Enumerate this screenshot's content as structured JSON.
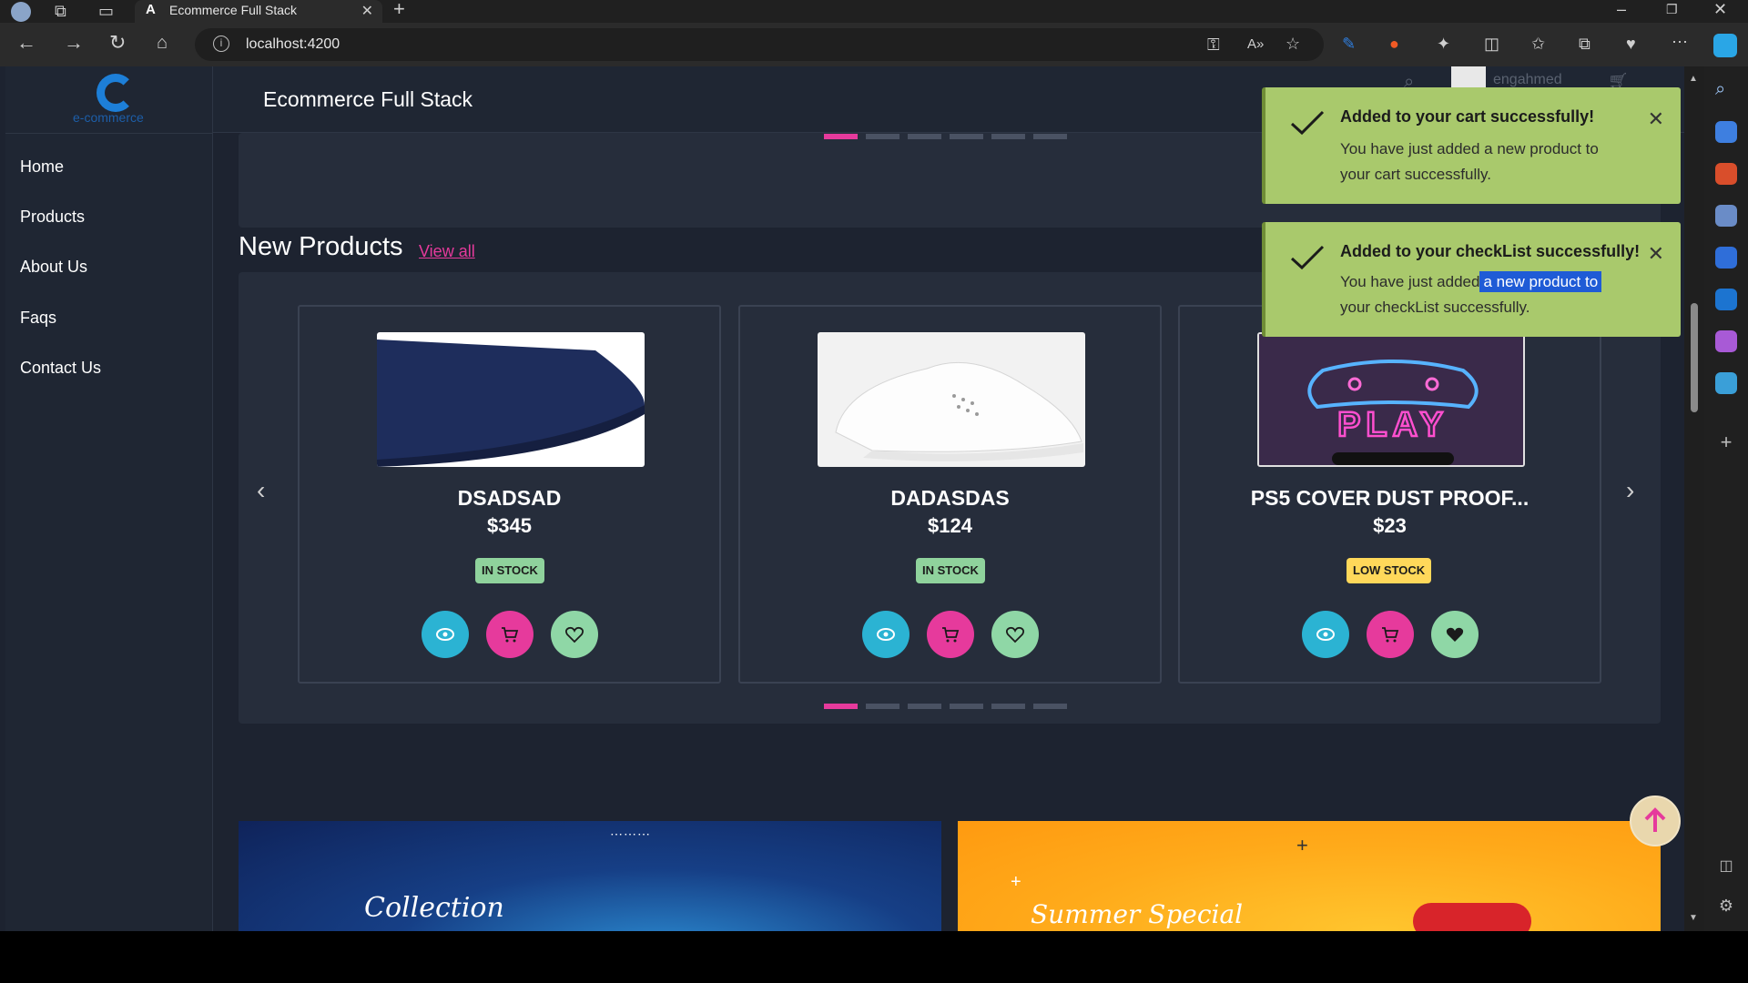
{
  "browser": {
    "tab_title": "Ecommerce Full Stack",
    "tab_icon": "angular-logo-icon",
    "url": "localhost:4200"
  },
  "sidebar": {
    "logo_text": "e-commerce",
    "items": [
      {
        "label": "Home"
      },
      {
        "label": "Products"
      },
      {
        "label": "About Us"
      },
      {
        "label": "Faqs"
      },
      {
        "label": "Contact Us"
      }
    ]
  },
  "header": {
    "title": "Ecommerce Full Stack",
    "username": "engahmed"
  },
  "section": {
    "title": "New Products",
    "view_all": "View all"
  },
  "products": [
    {
      "name": "DSADSAD",
      "price": "$345",
      "stock": "IN STOCK",
      "stock_color": "#8fd29c",
      "wishlisted": false
    },
    {
      "name": "DADASDAS",
      "price": "$124",
      "stock": "IN STOCK",
      "stock_color": "#8fd29c",
      "wishlisted": false
    },
    {
      "name": "PS5 COVER DUST PROOF...",
      "price": "$23",
      "stock": "LOW STOCK",
      "stock_color": "#ffd85a",
      "wishlisted": true
    }
  ],
  "product_image_text": "PLAY",
  "toasts": [
    {
      "title": "Added to your cart successfully!",
      "message_line1": "You have just added a new product to",
      "message_line2": "your cart successfully."
    },
    {
      "title": "Added to your checkList successfully!",
      "message_prefix": "You have just added",
      "message_selected": "a new product to",
      "message_line2": "your checkList successfully."
    }
  ],
  "banners": [
    {
      "text": "Collection"
    },
    {
      "text": "Summer Special"
    }
  ],
  "colors": {
    "accent": "#e63a9c",
    "view_button": "#2bb3d3",
    "cart_button": "#e63a9c",
    "wishlist_button": "#8fd7a6",
    "toast_bg": "#a9c96c"
  }
}
